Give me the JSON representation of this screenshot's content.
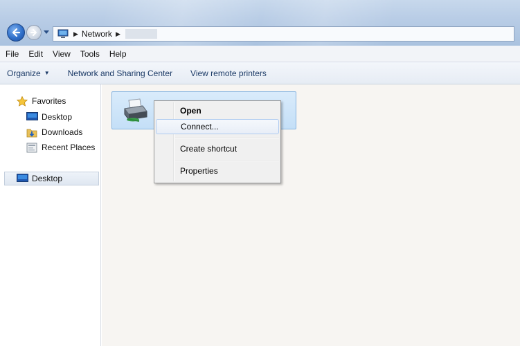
{
  "address": {
    "crumbs": [
      "Network"
    ],
    "icons": [
      "back-arrow-icon",
      "forward-arrow-icon",
      "history-dropdown-icon",
      "computer-icon",
      "chevron-right-icon"
    ]
  },
  "menubar": [
    "File",
    "Edit",
    "View",
    "Tools",
    "Help"
  ],
  "commandbar": {
    "organize": "Organize",
    "network_sharing": "Network and Sharing Center",
    "view_printers": "View remote printers"
  },
  "navpane": {
    "favorites": "Favorites",
    "items": [
      "Desktop",
      "Downloads",
      "Recent Places"
    ],
    "desktop_root": "Desktop"
  },
  "context_menu": {
    "open": "Open",
    "connect": "Connect...",
    "create_shortcut": "Create shortcut",
    "properties": "Properties"
  },
  "colors": {
    "selection_blue": "#c4dff7",
    "link_text": "#1b3a66",
    "menu_bg": "#f0f0f0"
  }
}
